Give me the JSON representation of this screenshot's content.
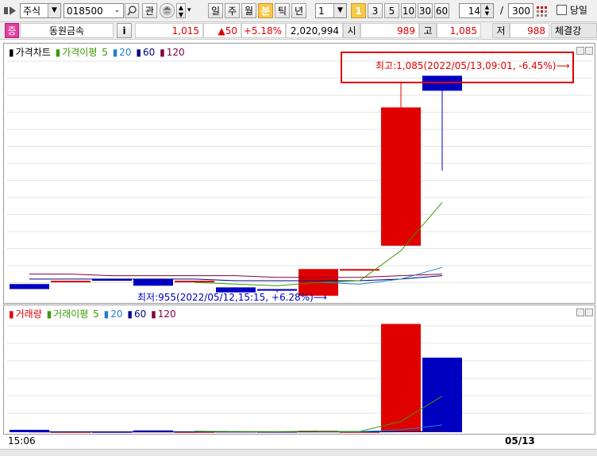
{
  "toolbar": {
    "market_select": "주식",
    "code_input": "018500",
    "watch_label": "관",
    "period_buttons": [
      "일",
      "주",
      "월",
      "분",
      "틱",
      "년"
    ],
    "active_period": "분",
    "interval_select": "1",
    "minute_buttons": [
      "1",
      "3",
      "5",
      "10",
      "30",
      "60"
    ],
    "active_minute": "1",
    "count_value": "14",
    "count_sep": "/",
    "total_value": "300",
    "today_label": "당일"
  },
  "quote": {
    "market_badge": "증",
    "stock_name": "동원금속",
    "info_label": "i",
    "price": "1,015",
    "change": "▲50",
    "change_pct": "+5.18%",
    "volume": "2,020,994",
    "open_label": "시",
    "open_value": "989",
    "high_label": "고",
    "high_value": "1,085",
    "low_label": "저",
    "low_value": "988",
    "extra_label": "체결강"
  },
  "price_pane": {
    "legend": {
      "title": "가격차트",
      "ma_label": "가격이평",
      "periods": [
        "5",
        "20",
        "60",
        "120"
      ]
    },
    "max_annotation": "최고:1,085(2022/05/13,09:01, -6.45%)⟶",
    "min_annotation": "최저:955(2022/05/12,15:15, +6.28%)⟶"
  },
  "volume_pane": {
    "legend": {
      "title": "거래량",
      "ma_label": "거래이평",
      "periods": [
        "5",
        "20",
        "60",
        "120"
      ]
    }
  },
  "time_axis": {
    "left_label": "15:06",
    "date_label": "05/13"
  },
  "colors": {
    "up": "#e00000",
    "down": "#0000c0",
    "ma5": "#3a9a00",
    "ma20": "#2080d0",
    "ma60": "#00008b",
    "ma120": "#800040",
    "highlight_box": "#e00000"
  },
  "chart_data": {
    "type": "candlestick",
    "candles": [
      {
        "open": 960,
        "close": 957,
        "high": 960,
        "low": 957
      },
      {
        "open": 962,
        "close": 962,
        "high": 962,
        "low": 962
      },
      {
        "open": 963,
        "close": 962,
        "high": 963,
        "low": 962
      },
      {
        "open": 963,
        "close": 959,
        "high": 963,
        "low": 959
      },
      {
        "open": 962,
        "close": 962,
        "high": 962,
        "low": 962
      },
      {
        "open": 958,
        "close": 955,
        "high": 958,
        "low": 955
      },
      {
        "open": 957,
        "close": 956,
        "high": 957,
        "low": 955
      },
      {
        "open": 953,
        "close": 969,
        "high": 969,
        "low": 953
      },
      {
        "open": 969,
        "close": 969,
        "high": 969,
        "low": 969
      },
      {
        "open": 983,
        "close": 1066,
        "high": 1081,
        "low": 983
      },
      {
        "open": 1085,
        "close": 1076,
        "high": 1085,
        "low": 1028
      }
    ],
    "volume": [
      20000,
      2000,
      2000,
      15000,
      2000,
      5000,
      3000,
      12000,
      2000,
      900000,
      620000
    ],
    "ma": {
      "5": [
        null,
        null,
        null,
        null,
        961,
        960,
        959,
        961,
        962,
        980,
        1009
      ],
      "20": [
        null,
        null,
        null,
        null,
        null,
        null,
        null,
        961,
        960,
        963,
        970
      ],
      "60": [
        963,
        963,
        963,
        963,
        963,
        962,
        962,
        962,
        962,
        963,
        965
      ],
      "120": [
        966,
        966,
        965,
        965,
        965,
        965,
        964,
        964,
        964,
        965,
        966
      ]
    },
    "volume_ma": {
      "5": [
        null,
        null,
        null,
        null,
        8000,
        6000,
        5000,
        7000,
        6000,
        90000,
        300000
      ],
      "20": [
        null,
        null,
        null,
        null,
        null,
        null,
        null,
        5000,
        5000,
        20000,
        60000
      ],
      "60": [
        3000,
        3000,
        3000,
        3000,
        3000,
        3000,
        3000,
        3000,
        3000,
        5000,
        8000
      ],
      "120": [
        2000,
        2000,
        2000,
        2000,
        2000,
        2000,
        2000,
        2000,
        2000,
        3000,
        4000
      ]
    },
    "ylim": [
      952,
      1090
    ]
  }
}
